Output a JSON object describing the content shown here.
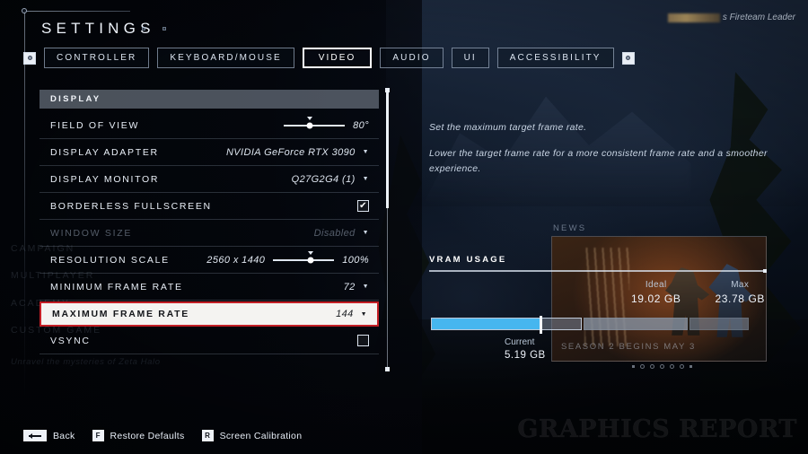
{
  "header": {
    "title": "SETTINGS",
    "fireteam_text": "s Fireteam Leader",
    "redacted_name": ""
  },
  "tabs": {
    "prev_arrow": "prev-tab",
    "next_arrow": "next-tab",
    "items": [
      {
        "label": "CONTROLLER",
        "active": false
      },
      {
        "label": "KEYBOARD/MOUSE",
        "active": false
      },
      {
        "label": "VIDEO",
        "active": true
      },
      {
        "label": "AUDIO",
        "active": false
      },
      {
        "label": "UI",
        "active": false
      },
      {
        "label": "ACCESSIBILITY",
        "active": false
      }
    ]
  },
  "panel": {
    "section_title": "DISPLAY",
    "ghost_items": [
      "CAMPAIGN",
      "MULTIPLAYER",
      "ACADEMY",
      "CUSTOM GAME"
    ],
    "ghost_subtitle": "Unravel the mysteries of Zeta Halo",
    "rows": [
      {
        "label": "FIELD OF VIEW",
        "type": "slider",
        "value": "80°",
        "prefix": "",
        "percent": 42,
        "dim": false,
        "selected": false
      },
      {
        "label": "DISPLAY ADAPTER",
        "type": "dropdown",
        "value": "NVIDIA GeForce RTX 3090",
        "dim": false,
        "selected": false
      },
      {
        "label": "DISPLAY MONITOR",
        "type": "dropdown",
        "value": "Q27G2G4 (1)",
        "dim": false,
        "selected": false
      },
      {
        "label": "BORDERLESS FULLSCREEN",
        "type": "checkbox",
        "value": "✔",
        "checked": true,
        "dim": false,
        "selected": false
      },
      {
        "label": "WINDOW SIZE",
        "type": "dropdown",
        "value": "Disabled",
        "dim": true,
        "selected": false
      },
      {
        "label": "RESOLUTION SCALE",
        "type": "slider",
        "prefix": "2560 x 1440",
        "value": "100%",
        "percent": 62,
        "dim": false,
        "selected": false
      },
      {
        "label": "MINIMUM FRAME RATE",
        "type": "dropdown",
        "value": "72",
        "dim": false,
        "selected": false
      },
      {
        "label": "MAXIMUM FRAME RATE",
        "type": "dropdown",
        "value": "144",
        "dim": false,
        "selected": true
      },
      {
        "label": "VSYNC",
        "type": "checkbox",
        "value": "",
        "checked": false,
        "dim": false,
        "selected": false
      }
    ]
  },
  "info": {
    "line1": "Set the maximum target frame rate.",
    "line2": "Lower the target frame rate for a more consistent frame rate and a smoother experience."
  },
  "vram": {
    "title": "VRAM USAGE",
    "ideal_label": "Ideal",
    "ideal_value": "19.02 GB",
    "max_label": "Max",
    "max_value": "23.78 GB",
    "current_label": "Current",
    "current_value": "5.19 GB",
    "fill_percent": 72,
    "accent_color": "#46b6ef"
  },
  "news": {
    "label": "NEWS",
    "caption": "SEASON 2 BEGINS MAY 3"
  },
  "footer": {
    "items": [
      {
        "key": "←",
        "label": "Back",
        "wide": true
      },
      {
        "key": "F",
        "label": "Restore Defaults",
        "wide": false
      },
      {
        "key": "R",
        "label": "Screen Calibration",
        "wide": false
      }
    ]
  },
  "watermark": "Graphics Report",
  "colors": {
    "selected_border": "#c41f26",
    "selected_bg": "#f4f3f1",
    "vram_fill": "#46b6ef"
  }
}
